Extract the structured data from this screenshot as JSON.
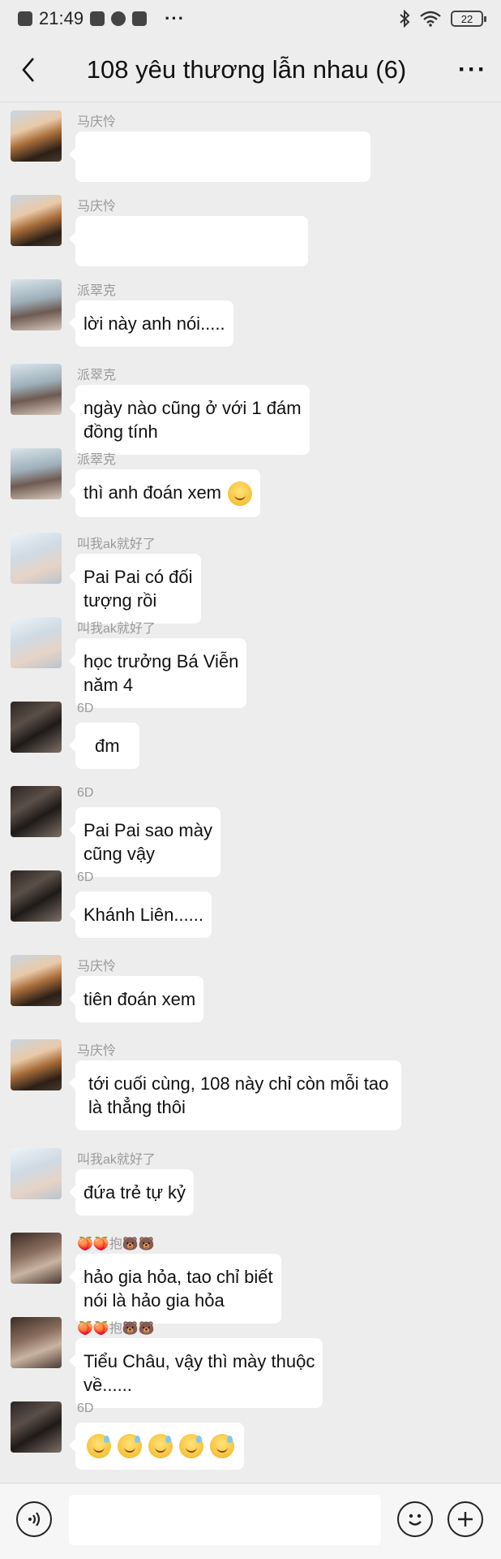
{
  "status_bar": {
    "time": "21:49",
    "more": "···",
    "battery": "22"
  },
  "nav": {
    "title": "108 yêu thương lẫn nhau (6)",
    "more": "···"
  },
  "messages": [
    {
      "sender": "马庆怜",
      "avatar": "ma",
      "text": ""
    },
    {
      "sender": "马庆怜",
      "avatar": "ma",
      "text": ""
    },
    {
      "sender": "派翠克",
      "avatar": "pai",
      "text": "lời này anh nói....."
    },
    {
      "sender": "派翠克",
      "avatar": "pai",
      "text": "ngày nào cũng ở với 1 đám\nđồng tính"
    },
    {
      "sender": "派翠克",
      "avatar": "pai",
      "text": "thì anh đoán xem",
      "emoji": "smiling-face"
    },
    {
      "sender": "叫我ak就好了",
      "avatar": "ak",
      "text": "Pai Pai có đối\ntượng rồi"
    },
    {
      "sender": "叫我ak就好了",
      "avatar": "ak",
      "text": "học trưởng Bá Viễn\nnăm 4"
    },
    {
      "sender": "6D",
      "avatar": "6d",
      "text": "đm"
    },
    {
      "sender": "6D",
      "avatar": "6d",
      "text": "Pai Pai sao mày\ncũng vậy"
    },
    {
      "sender": "6D",
      "avatar": "6d",
      "text": "Khánh Liên......"
    },
    {
      "sender": "马庆怜",
      "avatar": "ma",
      "text": "tiên đoán xem"
    },
    {
      "sender": "马庆怜",
      "avatar": "ma",
      "text": "tới cuối cùng, 108 này chỉ còn mỗi tao\nlà thẳng thôi"
    },
    {
      "sender": "叫我ak就好了",
      "avatar": "ak",
      "text": "đứa trẻ tự kỷ"
    },
    {
      "sender": "🍑🍑抱🐻🐻",
      "avatar": "bao",
      "text": "hảo gia hỏa, tao chỉ biết\nnói là hảo gia hỏa"
    },
    {
      "sender": "🍑🍑抱🐻🐻",
      "avatar": "bao",
      "text": "Tiểu Châu, vậy thì mày thuộc\nvề......"
    },
    {
      "sender": "6D",
      "avatar": "6d",
      "text": "",
      "emoji_row": "sweat-smile-x5"
    }
  ],
  "input": {
    "placeholder": ""
  },
  "icons": {
    "back": "back-chevron-icon",
    "voice": "voice-icon",
    "emoji": "emoji-icon",
    "plus": "plus-icon"
  }
}
